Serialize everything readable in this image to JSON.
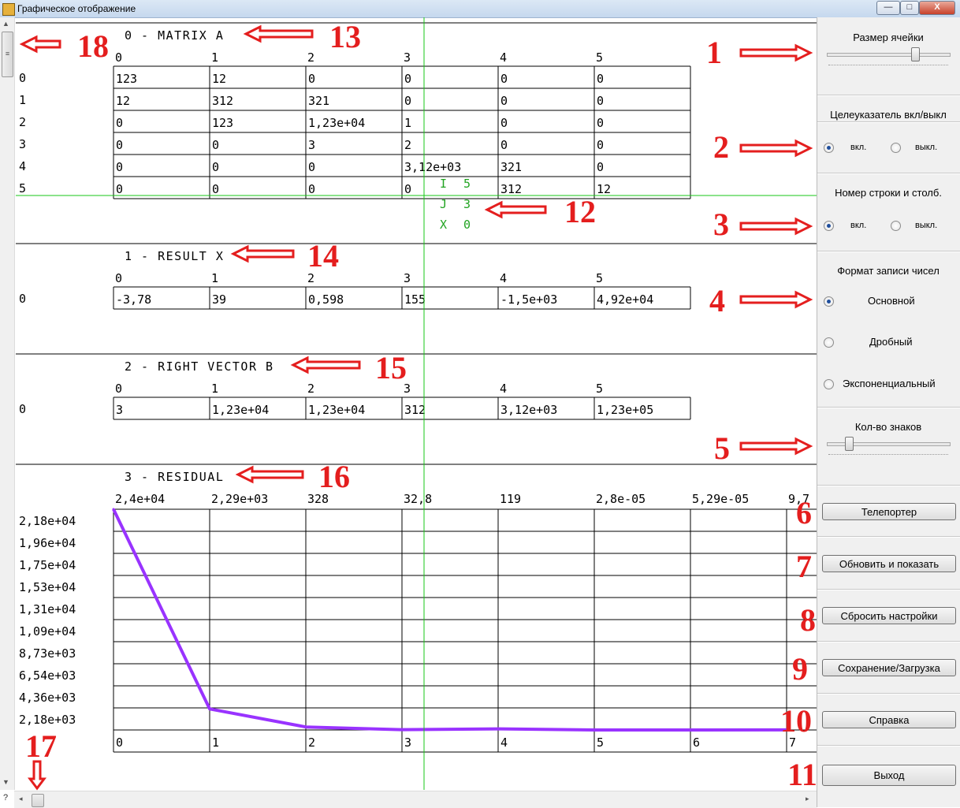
{
  "window": {
    "title": "Графическое отображение",
    "minimize_glyph": "—",
    "maximize_glyph": "□",
    "close_glyph": "X"
  },
  "panel": {
    "cell_size": {
      "title": "Размер ячейки",
      "slider_value": 0.72
    },
    "crosshair": {
      "title": "Целеуказатель вкл/выкл",
      "on_label": "вкл.",
      "off_label": "выкл.",
      "selected": "on"
    },
    "row_col_numbers": {
      "title": "Номер строки и столб.",
      "on_label": "вкл.",
      "off_label": "выкл.",
      "selected": "on"
    },
    "number_format": {
      "title": "Формат записи чисел",
      "options": [
        "Основной",
        "Дробный",
        "Экспоненциальный"
      ],
      "selected": "Основной"
    },
    "digits": {
      "title": "Кол-во знаков",
      "slider_value": 0.18
    },
    "buttons": [
      "Телепортер",
      "Обновить и показать",
      "Сбросить настройки",
      "Сохранение/Загрузка",
      "Справка",
      "Выход"
    ]
  },
  "scrollbars": {
    "help": "?",
    "up": "▲",
    "down": "▼",
    "left": "◂",
    "right": "▸",
    "grip": "≡"
  },
  "crosshair_readout": [
    "I 5",
    "J 3",
    "X 0"
  ],
  "matrix_a": {
    "title": "0 - MATRIX A",
    "col_headers": [
      "0",
      "1",
      "2",
      "3",
      "4",
      "5"
    ],
    "row_headers": [
      "0",
      "1",
      "2",
      "3",
      "4",
      "5"
    ],
    "rows": [
      [
        "123",
        "12",
        "0",
        "0",
        "0",
        "0"
      ],
      [
        "12",
        "312",
        "321",
        "0",
        "0",
        "0"
      ],
      [
        "0",
        "123",
        "1,23e+04",
        "1",
        "0",
        "0"
      ],
      [
        "0",
        "0",
        "3",
        "2",
        "0",
        "0"
      ],
      [
        "0",
        "0",
        "0",
        "3,12e+03",
        "321",
        "0"
      ],
      [
        "0",
        "0",
        "0",
        "0",
        "312",
        "12"
      ]
    ]
  },
  "result_x": {
    "title": "1 - RESULT X",
    "col_headers": [
      "0",
      "1",
      "2",
      "3",
      "4",
      "5"
    ],
    "row_headers": [
      "0"
    ],
    "rows": [
      [
        "-3,78",
        "39",
        "0,598",
        "155",
        "-1,5e+03",
        "4,92e+04"
      ]
    ]
  },
  "right_vector_b": {
    "title": "2 - RIGHT VECTOR B",
    "col_headers": [
      "0",
      "1",
      "2",
      "3",
      "4",
      "5"
    ],
    "row_headers": [
      "0"
    ],
    "rows": [
      [
        "3",
        "1,23e+04",
        "1,23e+04",
        "312",
        "3,12e+03",
        "1,23e+05"
      ]
    ]
  },
  "residual": {
    "title": "3 - RESIDUAL",
    "top_labels": [
      "2,4e+04",
      "2,29e+03",
      "328",
      "32,8",
      "119",
      "2,8e-05",
      "5,29e-05",
      "9,7"
    ],
    "y_labels": [
      "2,18e+04",
      "1,96e+04",
      "1,75e+04",
      "1,53e+04",
      "1,31e+04",
      "1,09e+04",
      "8,73e+03",
      "6,54e+03",
      "4,36e+03",
      "2,18e+03"
    ],
    "x_labels": [
      "0",
      "1",
      "2",
      "3",
      "4",
      "5",
      "6",
      "7"
    ],
    "line_color": "#9933ff"
  },
  "chart_data": {
    "type": "line",
    "title": "3 - RESIDUAL",
    "x": [
      0,
      1,
      2,
      3,
      4,
      5,
      6,
      7
    ],
    "series": [
      {
        "values": [
          24000,
          2290,
          328,
          32.8,
          119,
          2.8e-05,
          5.29e-05,
          9.7
        ]
      }
    ],
    "ylim": [
      0,
      24000
    ]
  },
  "annotations": {
    "color": "#e41e1e",
    "numbers": [
      "1",
      "2",
      "3",
      "4",
      "5",
      "6",
      "7",
      "8",
      "9",
      "10",
      "11",
      "12",
      "13",
      "14",
      "15",
      "16",
      "17",
      "18"
    ]
  },
  "colors": {
    "crosshair": "#17c717",
    "readout": "#21a321",
    "grid": "#000000"
  }
}
